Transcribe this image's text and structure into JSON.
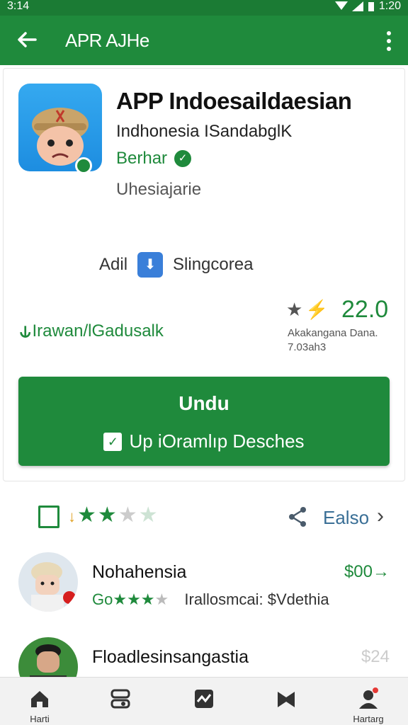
{
  "status_bar": {
    "time": "3:14",
    "clock": "1:20"
  },
  "app_bar": {
    "title": "APR AJHe"
  },
  "app": {
    "title": "APP Indoesaildaesian",
    "developer": "Indhonesia ISandabglK",
    "badge": "Berhar",
    "category": "Uhesiajarie"
  },
  "ad_row": {
    "ad_label": "Adil",
    "store_label": "Slingcorea"
  },
  "rating": {
    "score": "22.0",
    "sub1": "Akakangana Dana.",
    "sub2": "7.03ah3"
  },
  "feature": {
    "text": "Irawan/lGadusalk"
  },
  "install": {
    "label": "Undu",
    "secondary": "Up iOramlıp Desches"
  },
  "reviews_bar": {
    "more_label": "Ealso",
    "stars_filled": 3,
    "stars_total": 5
  },
  "reviews": [
    {
      "name": "Nohahensia",
      "price": "$00→",
      "meta_prefix": "Go",
      "meta_text": "Irallosmcai: $Vdethia",
      "stars_filled": 3
    },
    {
      "name": "Floadlesinsangastia",
      "price": "$24"
    }
  ],
  "bottom_nav": [
    {
      "label": "Harti",
      "icon": "home-icon"
    },
    {
      "label": "",
      "icon": "apps-icon"
    },
    {
      "label": "",
      "icon": "chart-icon"
    },
    {
      "label": "",
      "icon": "bookmark-icon"
    },
    {
      "label": "Hartarg",
      "icon": "profile-icon"
    }
  ],
  "colors": {
    "primary": "#1f8a3c",
    "status": "#1b7b34",
    "link": "#3a6f96"
  }
}
